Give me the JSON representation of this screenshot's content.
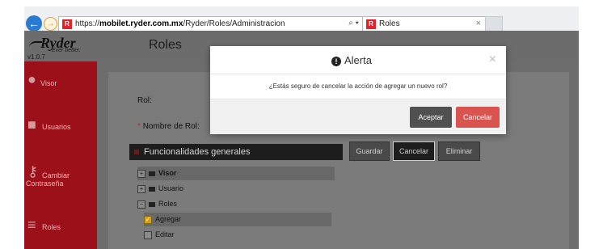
{
  "browser": {
    "url_prefix": "https://",
    "url_domain": "mobilet.ryder.com.mx",
    "url_path": "/Ryder/Roles/Administracion",
    "url_controls": "⌕ ▾ 🔒 C",
    "tab_title": "Roles",
    "tab_close": "×",
    "favicon_text": "R"
  },
  "header": {
    "logo_brand": "Ryder",
    "logo_tagline": "Ever better.",
    "version": "v1.0.7",
    "page_title": "Roles"
  },
  "sidebar": {
    "items": [
      {
        "label": "Visor",
        "icon": "map-pin-icon"
      },
      {
        "label": "Usuarios",
        "icon": "users-icon"
      },
      {
        "label": "Cambiar Contraseña",
        "icon": "key-icon"
      },
      {
        "label": "Roles",
        "icon": "list-icon"
      }
    ]
  },
  "form": {
    "rol_label": "Rol:",
    "nombre_label": "Nombre de Rol:",
    "required_mark": "*"
  },
  "functionalities": {
    "title": "Funcionalidades generales",
    "tree": [
      {
        "label": "Visor",
        "toggle": "+",
        "selected": true
      },
      {
        "label": "Usuario",
        "toggle": "+",
        "selected": false
      },
      {
        "label": "Roles",
        "toggle": "−",
        "selected": false
      },
      {
        "label": "Agregar",
        "toggle": "✓",
        "selected": true
      },
      {
        "label": "Editar",
        "toggle": "",
        "selected": false
      }
    ]
  },
  "actions": {
    "guardar": "Guardar",
    "cancelar": "Cancelar",
    "eliminar": "Eliminar"
  },
  "modal": {
    "title": "Alerta",
    "message": "¿Estás seguro de cancelar la acción de agregar un nuevo rol?",
    "accept": "Aceptar",
    "cancel": "Cancelar",
    "close": "×",
    "accept_color": "#505050",
    "cancel_color": "#d9534f"
  },
  "colors": {
    "sidebar": "#9b1019",
    "overlay": "#757575"
  }
}
